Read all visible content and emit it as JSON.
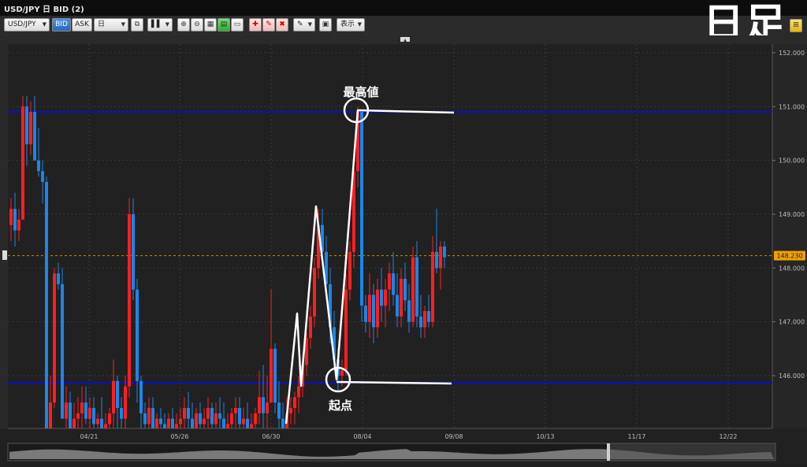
{
  "window": {
    "title": "USD/JPY 日 BID (2)"
  },
  "toolbar": {
    "symbol": "USD/JPY",
    "bid_label": "BID",
    "ask_label": "ASK",
    "period": "日",
    "display_label": "表示"
  },
  "overlay": {
    "big_title": "日足",
    "high_label": "最高値",
    "start_label": "起点"
  },
  "colors": {
    "up": "#ff1f1f",
    "down": "#1a86e8",
    "hline": "#0a10c8",
    "price_tag": "#f0a000"
  },
  "chart_data": {
    "type": "candlestick",
    "y_ticks": [
      "152.000",
      "151.000",
      "150.000",
      "149.000",
      "148.000",
      "147.000",
      "146.000"
    ],
    "y_range": [
      145.55,
      152.0
    ],
    "x_ticks": [
      "04/21",
      "05/26",
      "06/30",
      "08/04",
      "09/08",
      "10/13",
      "11/17",
      "12/22"
    ],
    "current_price": "148.230",
    "horizontal_lines": [
      {
        "value": 150.9
      },
      {
        "value": 145.87
      }
    ],
    "candles": [
      [
        148.8,
        149.3,
        148.5,
        149.1
      ],
      [
        149.1,
        149.4,
        148.4,
        148.7
      ],
      [
        148.7,
        149.1,
        148.5,
        148.9
      ],
      [
        148.9,
        151.2,
        148.9,
        151.0
      ],
      [
        151.0,
        151.2,
        149.9,
        150.3
      ],
      [
        150.3,
        151.1,
        150.1,
        150.9
      ],
      [
        150.9,
        151.2,
        150.2,
        150.0
      ],
      [
        150.0,
        150.6,
        149.7,
        149.8
      ],
      [
        149.8,
        150.0,
        149.2,
        149.6
      ],
      [
        149.6,
        149.7,
        144.9,
        145.0
      ],
      [
        145.0,
        146.0,
        144.7,
        145.5
      ],
      [
        145.5,
        148.0,
        145.4,
        147.9
      ],
      [
        147.9,
        148.1,
        147.6,
        147.7
      ],
      [
        147.7,
        148.0,
        147.4,
        145.2
      ],
      [
        145.2,
        145.8,
        144.9,
        145.5
      ],
      [
        145.5,
        145.7,
        144.8,
        145.0
      ],
      [
        145.0,
        145.5,
        144.7,
        145.2
      ],
      [
        145.2,
        145.6,
        144.9,
        145.3
      ],
      [
        145.3,
        145.8,
        145.0,
        145.5
      ],
      [
        145.5,
        145.8,
        145.1,
        145.2
      ],
      [
        145.2,
        145.6,
        144.8,
        145.4
      ],
      [
        145.4,
        145.6,
        144.9,
        145.1
      ],
      [
        145.1,
        145.3,
        144.8,
        145.2
      ],
      [
        145.2,
        145.6,
        144.7,
        145.0
      ],
      [
        145.0,
        145.3,
        144.8,
        145.1
      ],
      [
        145.1,
        145.4,
        144.9,
        145.3
      ],
      [
        145.3,
        146.3,
        145.0,
        145.9
      ],
      [
        145.9,
        146.0,
        145.0,
        145.4
      ],
      [
        145.4,
        145.6,
        144.8,
        145.2
      ],
      [
        145.2,
        146.0,
        144.9,
        145.8
      ],
      [
        145.8,
        149.3,
        145.6,
        149.0
      ],
      [
        149.0,
        149.3,
        147.4,
        147.6
      ],
      [
        147.6,
        147.8,
        145.5,
        145.9
      ],
      [
        145.9,
        146.0,
        145.0,
        145.3
      ],
      [
        145.3,
        145.5,
        144.9,
        145.1
      ],
      [
        145.1,
        145.6,
        144.8,
        145.4
      ],
      [
        145.4,
        145.6,
        144.8,
        145.0
      ],
      [
        145.0,
        145.3,
        144.7,
        145.2
      ],
      [
        145.2,
        145.4,
        144.9,
        145.1
      ],
      [
        145.1,
        145.3,
        144.8,
        145.0
      ],
      [
        145.0,
        145.3,
        144.7,
        145.2
      ],
      [
        145.2,
        145.4,
        144.8,
        145.0
      ],
      [
        145.0,
        145.3,
        144.8,
        145.1
      ],
      [
        145.1,
        145.4,
        144.9,
        145.2
      ],
      [
        145.2,
        145.6,
        144.9,
        145.4
      ],
      [
        145.4,
        145.7,
        145.0,
        145.2
      ],
      [
        145.2,
        145.5,
        144.8,
        145.0
      ],
      [
        145.0,
        145.4,
        144.8,
        145.3
      ],
      [
        145.3,
        145.5,
        144.9,
        145.1
      ],
      [
        145.1,
        145.4,
        144.8,
        145.2
      ],
      [
        145.2,
        145.6,
        145.0,
        145.4
      ],
      [
        145.4,
        145.5,
        144.9,
        145.1
      ],
      [
        145.1,
        145.5,
        144.8,
        145.3
      ],
      [
        145.3,
        145.6,
        145.0,
        145.2
      ],
      [
        145.2,
        145.5,
        144.9,
        145.0
      ],
      [
        145.0,
        145.3,
        144.7,
        145.1
      ],
      [
        145.1,
        145.4,
        144.9,
        145.3
      ],
      [
        145.3,
        145.6,
        145.0,
        145.4
      ],
      [
        145.4,
        145.6,
        144.9,
        145.1
      ],
      [
        145.1,
        145.4,
        144.8,
        145.2
      ],
      [
        145.2,
        145.5,
        144.9,
        145.0
      ],
      [
        145.0,
        145.3,
        144.7,
        145.1
      ],
      [
        145.1,
        145.4,
        144.8,
        145.3
      ],
      [
        145.3,
        146.1,
        145.1,
        145.6
      ],
      [
        145.6,
        146.2,
        145.0,
        145.3
      ],
      [
        145.3,
        146.0,
        144.9,
        145.5
      ],
      [
        145.5,
        147.6,
        145.5,
        146.5
      ],
      [
        146.5,
        146.6,
        145.3,
        145.5
      ],
      [
        145.5,
        145.9,
        145.0,
        145.2
      ],
      [
        145.2,
        145.5,
        144.8,
        145.0
      ],
      [
        145.0,
        145.6,
        144.9,
        145.3
      ],
      [
        145.3,
        145.6,
        145.1,
        145.4
      ],
      [
        145.4,
        145.7,
        145.1,
        145.6
      ],
      [
        145.6,
        146.0,
        145.3,
        145.8
      ],
      [
        145.8,
        146.4,
        145.6,
        146.2
      ],
      [
        146.2,
        146.8,
        146.0,
        146.7
      ],
      [
        146.7,
        147.3,
        146.5,
        147.1
      ],
      [
        147.1,
        148.2,
        146.9,
        148.0
      ],
      [
        148.0,
        149.1,
        147.8,
        148.8
      ],
      [
        148.8,
        149.1,
        148.2,
        148.3
      ],
      [
        148.3,
        148.6,
        147.5,
        147.7
      ],
      [
        147.7,
        148.0,
        146.6,
        146.9
      ],
      [
        146.9,
        147.2,
        146.1,
        146.3
      ],
      [
        146.3,
        146.5,
        145.7,
        146.0
      ],
      [
        146.0,
        146.3,
        145.8,
        146.1
      ],
      [
        146.1,
        147.9,
        146.0,
        147.6
      ],
      [
        147.6,
        148.5,
        147.4,
        148.3
      ],
      [
        148.3,
        150.2,
        148.0,
        149.8
      ],
      [
        149.8,
        151.0,
        149.5,
        150.9
      ],
      [
        150.9,
        150.9,
        147.0,
        147.3
      ],
      [
        147.3,
        147.5,
        146.8,
        147.0
      ],
      [
        147.0,
        147.9,
        146.7,
        147.5
      ],
      [
        147.5,
        147.7,
        146.6,
        146.9
      ],
      [
        146.9,
        147.8,
        146.7,
        147.6
      ],
      [
        147.6,
        148.0,
        147.0,
        147.3
      ],
      [
        147.3,
        147.8,
        146.9,
        147.6
      ],
      [
        147.6,
        148.1,
        147.2,
        147.9
      ],
      [
        147.9,
        148.3,
        147.3,
        147.5
      ],
      [
        147.5,
        147.9,
        146.9,
        147.1
      ],
      [
        147.1,
        148.0,
        146.9,
        147.8
      ],
      [
        147.8,
        148.1,
        147.2,
        147.4
      ],
      [
        147.4,
        147.7,
        146.8,
        147.0
      ],
      [
        147.0,
        148.4,
        146.9,
        148.2
      ],
      [
        148.2,
        148.5,
        146.9,
        147.1
      ],
      [
        147.1,
        147.5,
        146.7,
        146.9
      ],
      [
        146.9,
        147.3,
        146.7,
        147.2
      ],
      [
        147.2,
        147.5,
        146.9,
        147.0
      ],
      [
        147.0,
        148.6,
        146.9,
        148.3
      ],
      [
        148.3,
        149.1,
        147.9,
        148.0
      ],
      [
        148.0,
        148.5,
        147.6,
        148.4
      ],
      [
        148.4,
        148.5,
        148.0,
        148.2
      ]
    ]
  }
}
